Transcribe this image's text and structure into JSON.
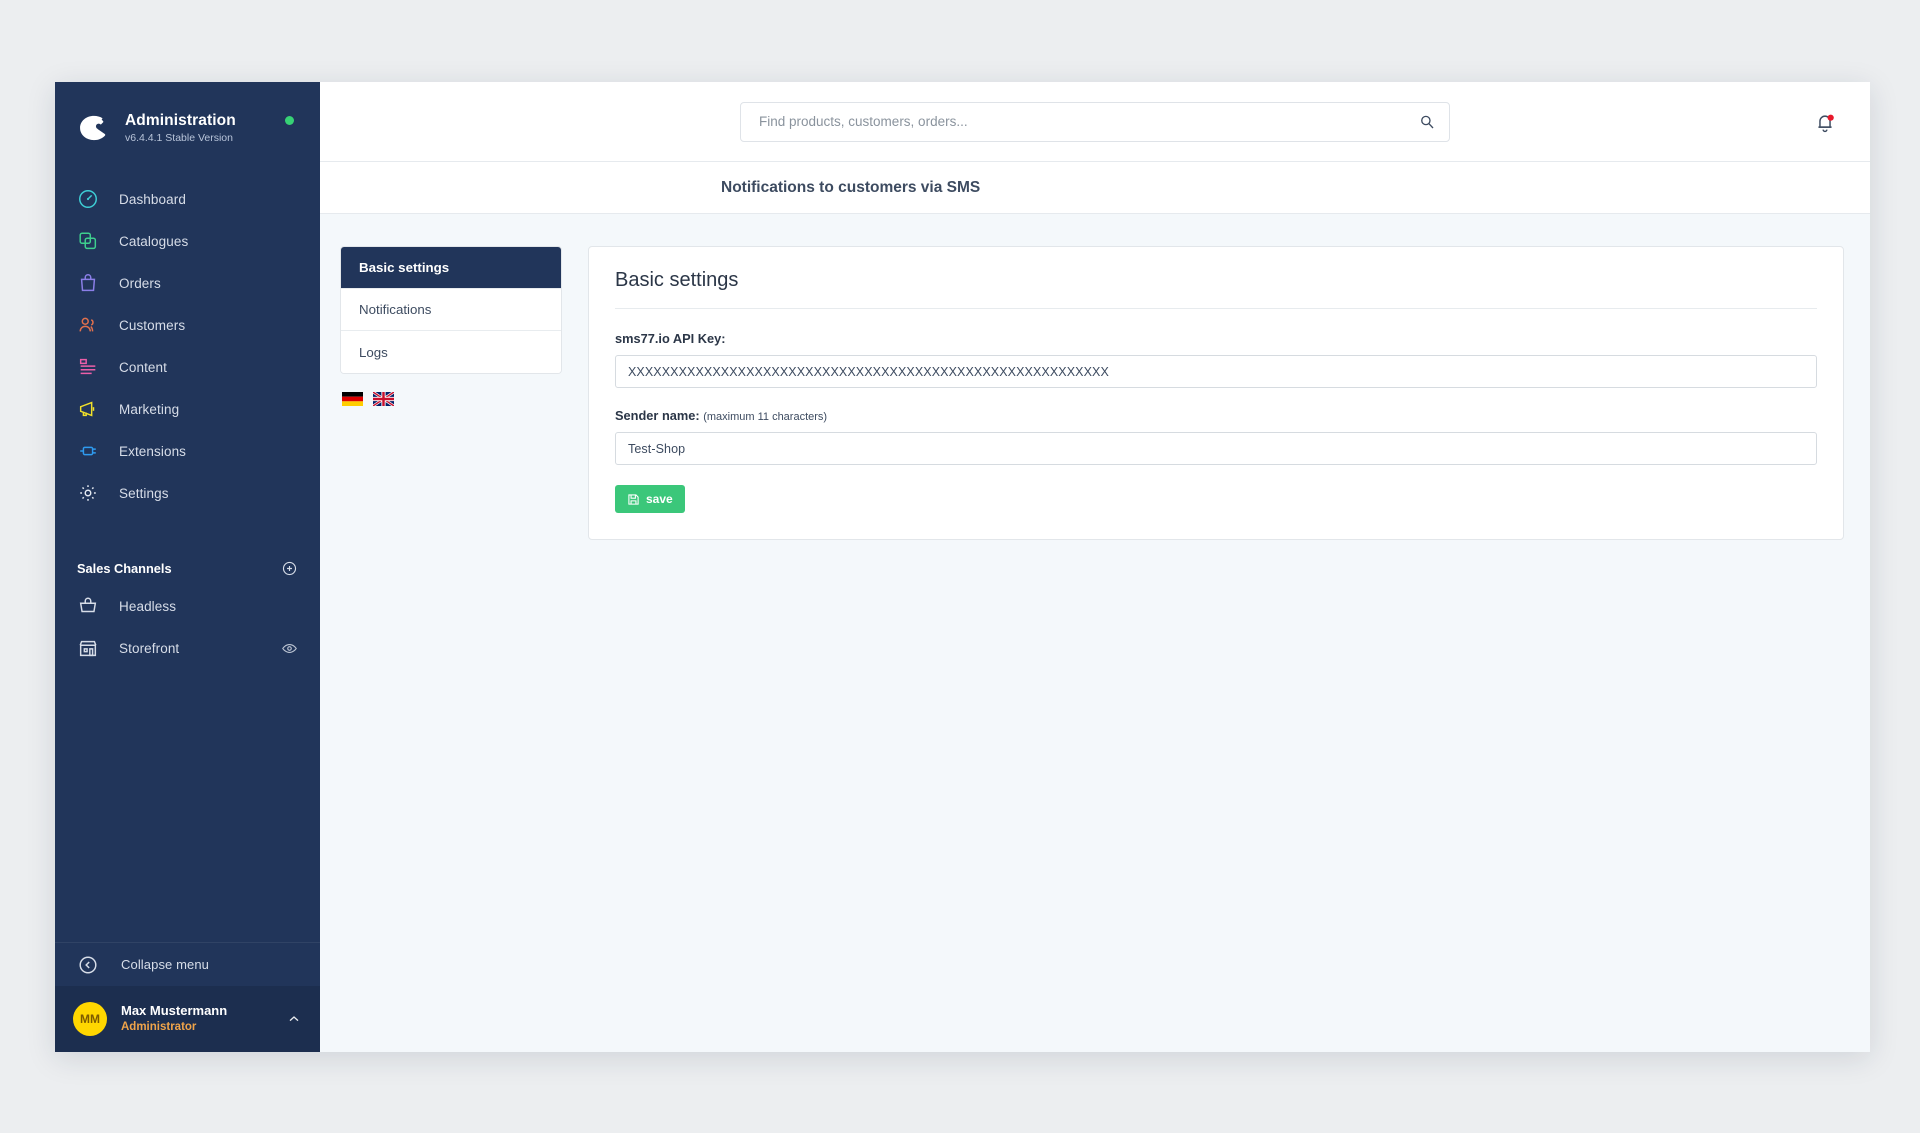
{
  "sidebar": {
    "brand": {
      "title": "Administration",
      "version": "v6.4.4.1 Stable Version",
      "logo_icon": "shopware-logo-icon",
      "status_icon": "status-online-dot"
    },
    "nav_items": [
      {
        "label": "Dashboard",
        "icon": "speedometer-icon",
        "color": "#3ecfd6"
      },
      {
        "label": "Catalogues",
        "icon": "copy-icon",
        "color": "#3ecf8e"
      },
      {
        "label": "Orders",
        "icon": "bag-icon",
        "color": "#8b7fe8"
      },
      {
        "label": "Customers",
        "icon": "users-icon",
        "color": "#e2714d"
      },
      {
        "label": "Content",
        "icon": "content-icon",
        "color": "#ec5fa8"
      },
      {
        "label": "Marketing",
        "icon": "megaphone-icon",
        "color": "#f0e02a"
      },
      {
        "label": "Extensions",
        "icon": "plug-icon",
        "color": "#2f9bf0"
      },
      {
        "label": "Settings",
        "icon": "gear-icon",
        "color": "#e5eaf2"
      }
    ],
    "sales_channels": {
      "title": "Sales Channels",
      "add_icon": "plus-circle-icon",
      "items": [
        {
          "label": "Headless",
          "icon": "basket-icon",
          "trailing_icon": ""
        },
        {
          "label": "Storefront",
          "icon": "store-icon",
          "trailing_icon": "eye-icon"
        }
      ]
    },
    "collapse": {
      "label": "Collapse menu",
      "icon": "chevron-left-circle-icon"
    },
    "user": {
      "initials": "MM",
      "name": "Max Mustermann",
      "role": "Administrator",
      "chevron_icon": "chevron-up-icon"
    }
  },
  "topbar": {
    "search": {
      "placeholder": "Find products, customers, orders...",
      "value": "",
      "icon": "search-icon"
    },
    "notifications_icon": "bell-icon"
  },
  "page": {
    "title": "Notifications to customers via SMS"
  },
  "subnav": {
    "items": [
      {
        "label": "Basic settings",
        "active": true
      },
      {
        "label": "Notifications",
        "active": false
      },
      {
        "label": "Logs",
        "active": false
      }
    ],
    "languages": [
      {
        "name": "german-flag-icon",
        "label": "German"
      },
      {
        "name": "uk-flag-icon",
        "label": "English"
      }
    ]
  },
  "card": {
    "title": "Basic settings",
    "fields": [
      {
        "label": "sms77.io API Key:",
        "hint": "",
        "value": "XXXXXXXXXXXXXXXXXXXXXXXXXXXXXXXXXXXXXXXXXXXXXXXXXXXXXXXXX"
      },
      {
        "label": "Sender name:",
        "hint": "(maximum 11 characters)",
        "value": "Test-Shop"
      }
    ],
    "save_button": {
      "label": "save",
      "icon": "floppy-save-icon"
    }
  },
  "colors": {
    "sidebar_bg": "#21355a",
    "accent_green": "#3bc77a",
    "status_green": "#37d275",
    "avatar_yellow": "#ffd700",
    "role_orange": "#f0a44a",
    "page_bg": "#f4f8fb"
  }
}
